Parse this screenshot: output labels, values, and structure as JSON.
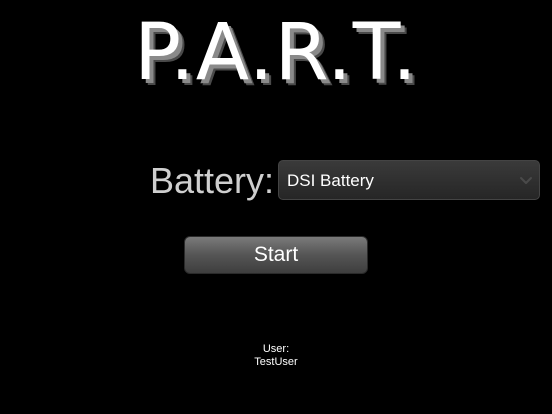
{
  "app": {
    "logo": "P.A.R.T."
  },
  "battery": {
    "label": "Battery:",
    "selected": "DSI Battery"
  },
  "actions": {
    "start_label": "Start"
  },
  "user": {
    "label": "User:",
    "name": "TestUser"
  },
  "icons": {
    "dropdown": "chevron-down-icon"
  }
}
